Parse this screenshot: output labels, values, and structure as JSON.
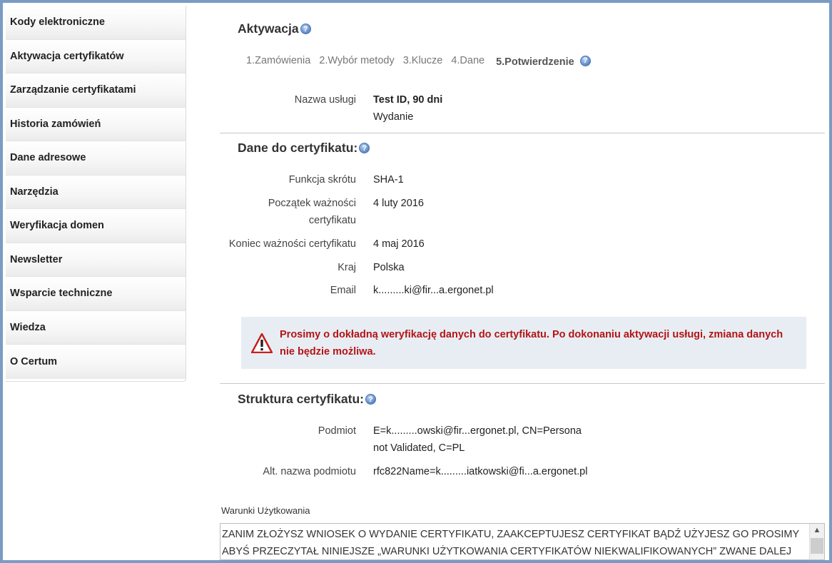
{
  "sidebar": {
    "items": [
      {
        "label": "Kody elektroniczne"
      },
      {
        "label": "Aktywacja certyfikatów"
      },
      {
        "label": "Zarządzanie certyfikatami"
      },
      {
        "label": "Historia zamówień"
      },
      {
        "label": "Dane adresowe"
      },
      {
        "label": "Narzędzia"
      },
      {
        "label": "Weryfikacja domen"
      },
      {
        "label": "Newsletter"
      },
      {
        "label": "Wsparcie techniczne"
      },
      {
        "label": "Wiedza"
      },
      {
        "label": "O Certum"
      }
    ]
  },
  "activation": {
    "title": "Aktywacja",
    "steps": [
      "1.Zamówienia",
      "2.Wybór metody",
      "3.Klucze",
      "4.Dane"
    ],
    "active_step": "5.Potwierdzenie",
    "service_label": "Nazwa usługi",
    "service_value": "Test ID, 90 dni",
    "service_sub": "Wydanie"
  },
  "cert_data": {
    "title": "Dane do certyfikatu:",
    "hash_label": "Funkcja skrótu",
    "hash_value": "SHA-1",
    "start_label": "Początek ważności certyfikatu",
    "start_value": "4 luty 2016",
    "end_label": "Koniec ważności certyfikatu",
    "end_value": "4 maj 2016",
    "country_label": "Kraj",
    "country_value": "Polska",
    "email_label": "Email",
    "email_value": "k.........ki@fir...a.ergonet.pl"
  },
  "warning": {
    "text": "Prosimy o dokładną weryfikację danych do certyfikatu. Po dokonaniu aktywacji usługi, zmiana danych nie będzie możliwa."
  },
  "structure": {
    "title": "Struktura certyfikatu:",
    "subject_label": "Podmiot",
    "subject_value": "E=k.........owski@fir...ergonet.pl, CN=Persona not Validated, C=PL",
    "alt_label": "Alt. nazwa podmiotu",
    "alt_value": "rfc822Name=k.........iatkowski@fi...a.ergonet.pl"
  },
  "terms": {
    "label": "Warunki Użytkowania",
    "text": "ZANIM ZŁOŻYSZ WNIOSEK O WYDANIE CERTYFIKATU, ZAAKCEPTUJESZ CERTYFIKAT BĄDŹ UŻYJESZ GO PROSIMY ABYŚ PRZECZYTAŁ NINIEJSZE „WARUNKI UŻYTKOWANIA CERTYFIKATÓW NIEKWALIFIKOWANYCH” ZWANE DALEJ"
  },
  "icons": {
    "help": "help-icon",
    "warning": "warning-triangle-icon"
  },
  "colors": {
    "warning_text": "#b31414",
    "warning_bg": "#e8edf4",
    "frame": "#7a9bc4"
  }
}
